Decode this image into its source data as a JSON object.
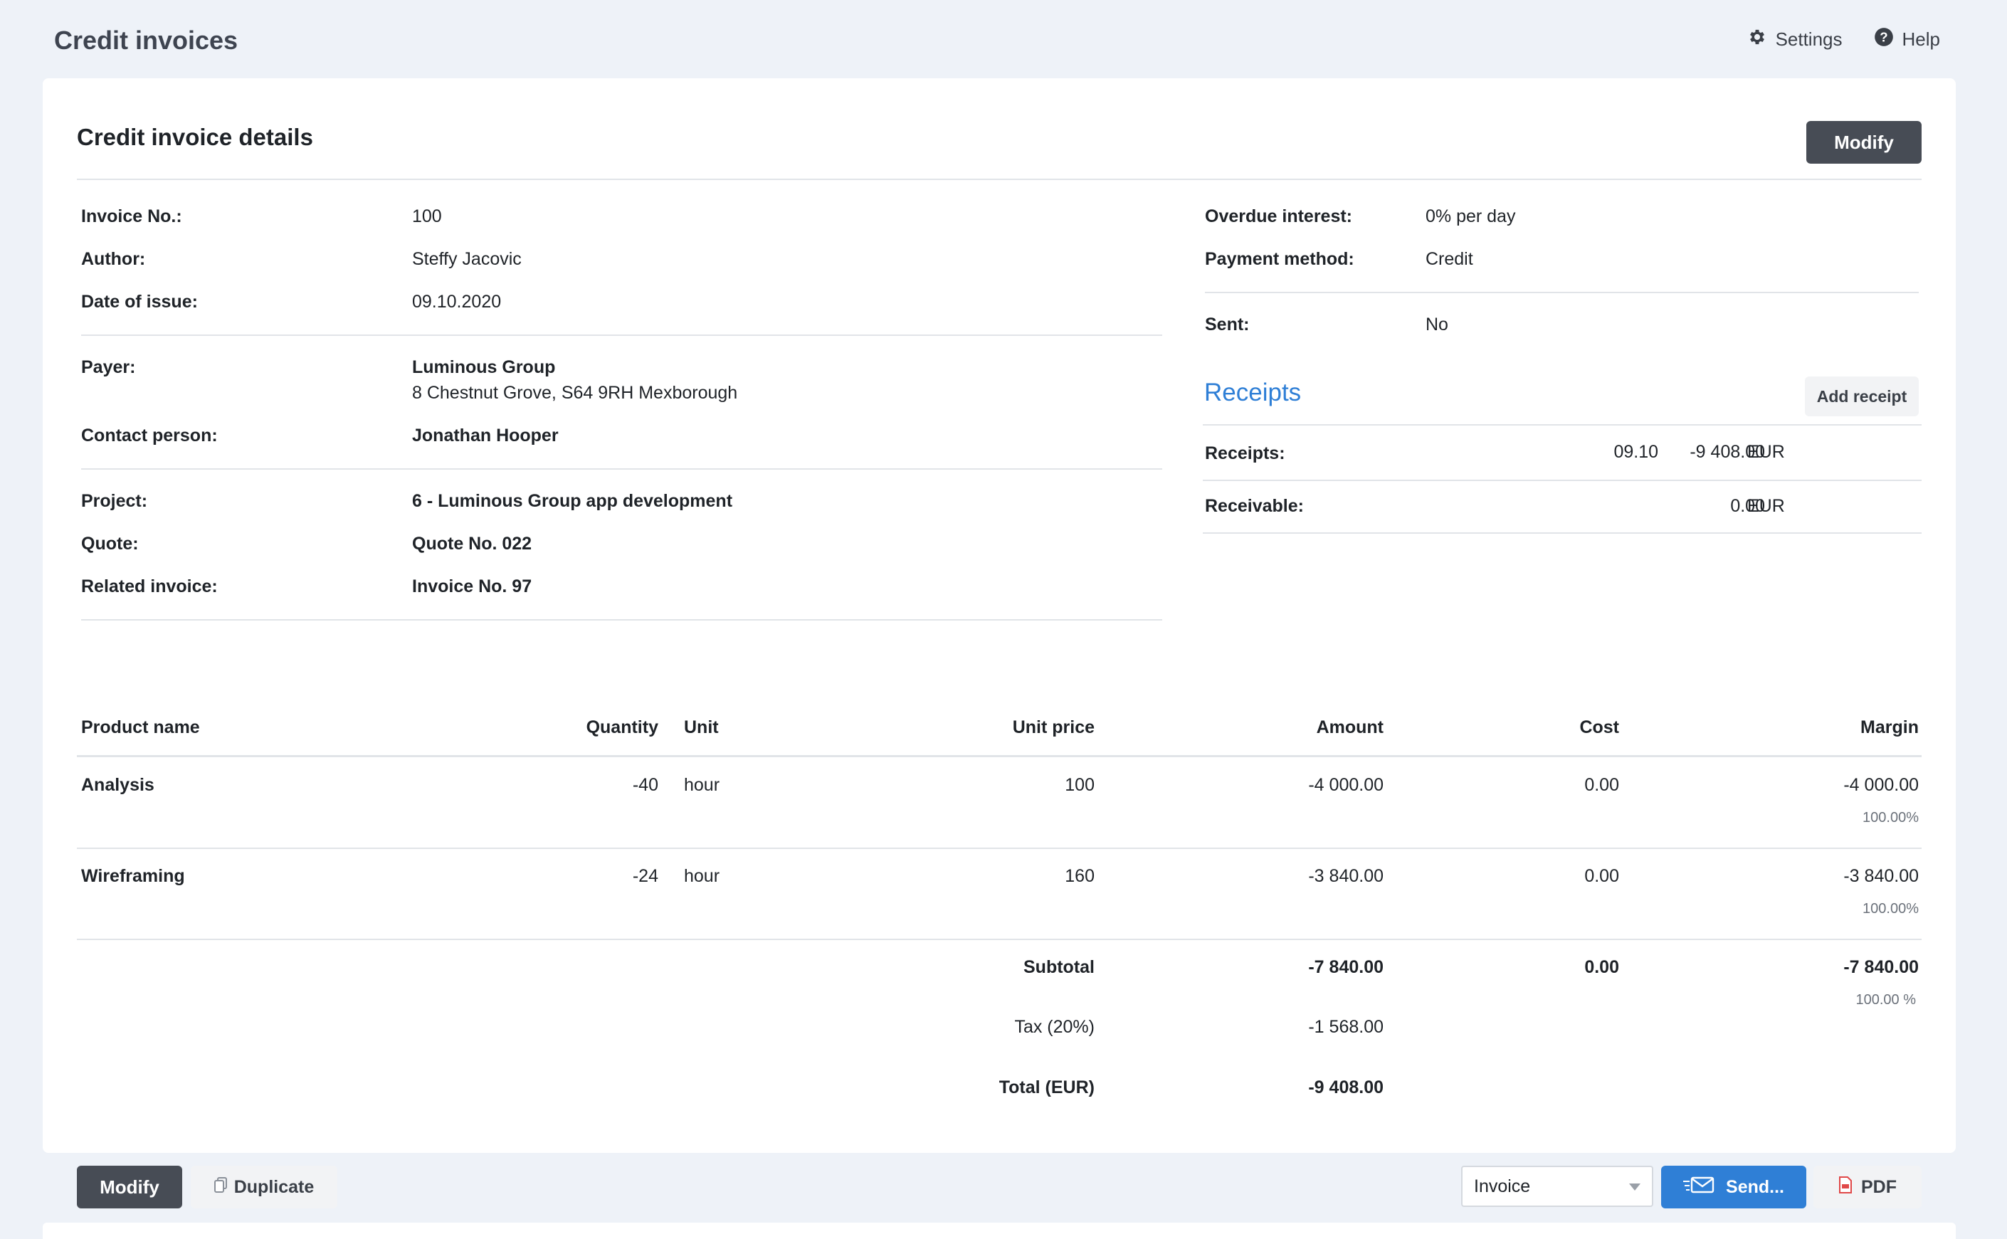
{
  "header": {
    "title": "Credit invoices",
    "settings_label": "Settings",
    "help_label": "Help"
  },
  "card": {
    "title": "Credit invoice details",
    "modify_label": "Modify"
  },
  "details_left": {
    "invoice_no_label": "Invoice No.:",
    "invoice_no": "100",
    "author_label": "Author:",
    "author": "Steffy Jacovic",
    "date_label": "Date of issue:",
    "date": "09.10.2020",
    "payer_label": "Payer:",
    "payer_name": "Luminous Group",
    "payer_address": "8 Chestnut Grove, S64 9RH Mexborough",
    "contact_label": "Contact person:",
    "contact": "Jonathan Hooper",
    "project_label": "Project:",
    "project": "6 - Luminous Group app development",
    "quote_label": "Quote:",
    "quote": "Quote No. 022",
    "related_label": "Related invoice:",
    "related": "Invoice No. 97"
  },
  "details_right": {
    "overdue_label": "Overdue interest:",
    "overdue": "0% per day",
    "payment_label": "Payment method:",
    "payment": "Credit",
    "sent_label": "Sent:",
    "sent": "No"
  },
  "receipts": {
    "title": "Receipts",
    "add_label": "Add receipt",
    "receipts_label": "Receipts:",
    "receipt_date": "09.10",
    "receipt_amount": "-9 408.00",
    "receipt_currency": "EUR",
    "receivable_label": "Receivable:",
    "receivable_amount": "0.00",
    "receivable_currency": "EUR"
  },
  "table": {
    "headers": {
      "product": "Product name",
      "quantity": "Quantity",
      "unit": "Unit",
      "unit_price": "Unit price",
      "amount": "Amount",
      "cost": "Cost",
      "margin": "Margin"
    },
    "rows": [
      {
        "product": "Analysis",
        "quantity": "-40",
        "unit": "hour",
        "unit_price": "100",
        "amount": "-4 000.00",
        "cost": "0.00",
        "margin": "-4 000.00",
        "margin_pct": "100.00%"
      },
      {
        "product": "Wireframing",
        "quantity": "-24",
        "unit": "hour",
        "unit_price": "160",
        "amount": "-3 840.00",
        "cost": "0.00",
        "margin": "-3 840.00",
        "margin_pct": "100.00%"
      }
    ],
    "subtotal_label": "Subtotal",
    "subtotal_amount": "-7 840.00",
    "subtotal_cost": "0.00",
    "subtotal_margin": "-7 840.00",
    "subtotal_margin_pct": "100.00 %",
    "tax_label": "Tax (20%)",
    "tax_amount": "-1 568.00",
    "total_label": "Total (EUR)",
    "total_amount": "-9 408.00"
  },
  "footer": {
    "modify_label": "Modify",
    "duplicate_label": "Duplicate",
    "select_value": "Invoice",
    "send_label": "Send...",
    "pdf_label": "PDF"
  },
  "colors": {
    "accent": "#2f7fd6",
    "dark_button": "#474c55",
    "background": "#eef2f8"
  }
}
